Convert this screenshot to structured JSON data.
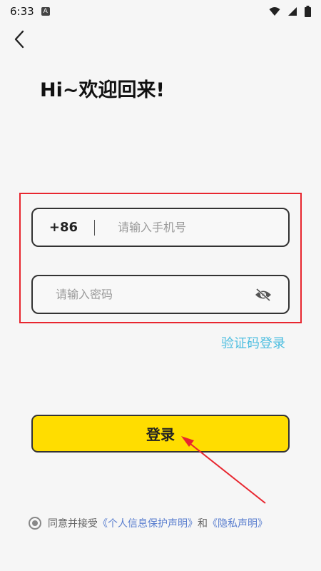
{
  "status_bar": {
    "time": "6:33",
    "notification_letter": "A"
  },
  "header": {
    "title": "Hi~欢迎回来!"
  },
  "form": {
    "country_code": "+86",
    "phone_placeholder": "请输入手机号",
    "password_placeholder": "请输入密码",
    "sms_login_label": "验证码登录",
    "login_label": "登录"
  },
  "agreement": {
    "prefix": "同意并接受",
    "privacy_protection_link": "《个人信息保护声明》",
    "conjunction": "和",
    "privacy_link": "《隐私声明》"
  },
  "colors": {
    "accent": "#ffdd00",
    "link": "#5b7fcf",
    "sms_link": "#4dbee0",
    "annotation": "#e8262f"
  }
}
